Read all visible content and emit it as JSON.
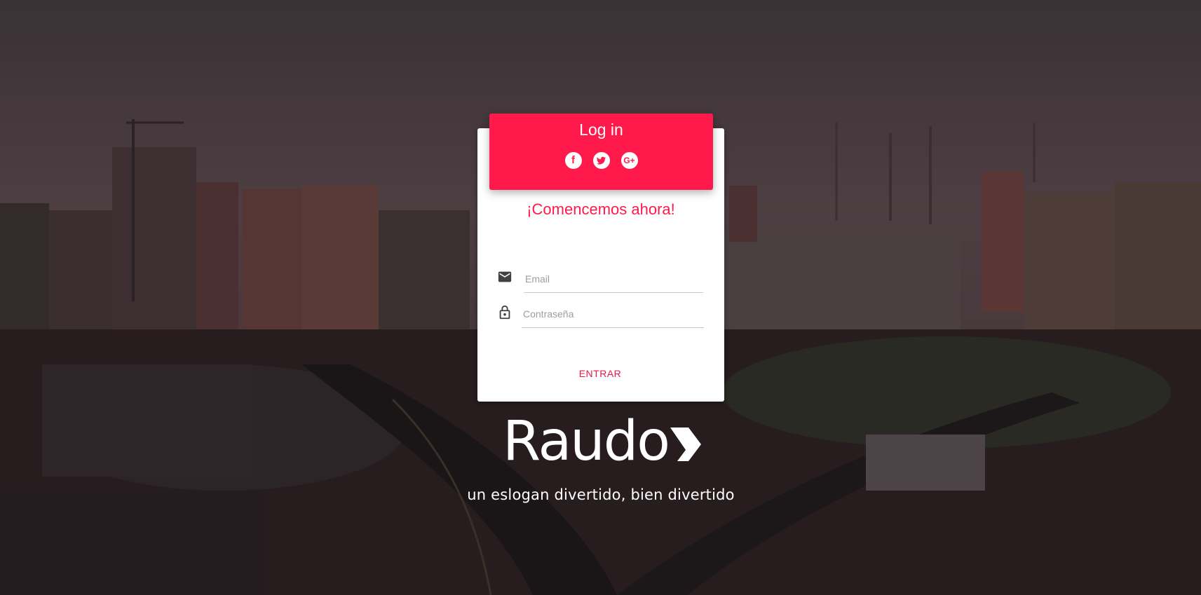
{
  "login": {
    "title": "Log in",
    "social_buttons": [
      {
        "icon": "facebook-icon",
        "glyph": "f"
      },
      {
        "icon": "twitter-icon",
        "glyph": "t"
      },
      {
        "icon": "google-plus-icon",
        "glyph": "G+"
      }
    ],
    "subtitle": "¡Comencemos ahora!",
    "email_placeholder": "Email",
    "password_placeholder": "Contraseña",
    "submit_label": "ENTRAR"
  },
  "brand": {
    "logo_text": "Raudo",
    "slogan": "un eslogan divertido, bien divertido"
  },
  "colors": {
    "accent": "#ff1a4b",
    "card_bg": "#ffffff",
    "icon_gray": "#424242"
  }
}
